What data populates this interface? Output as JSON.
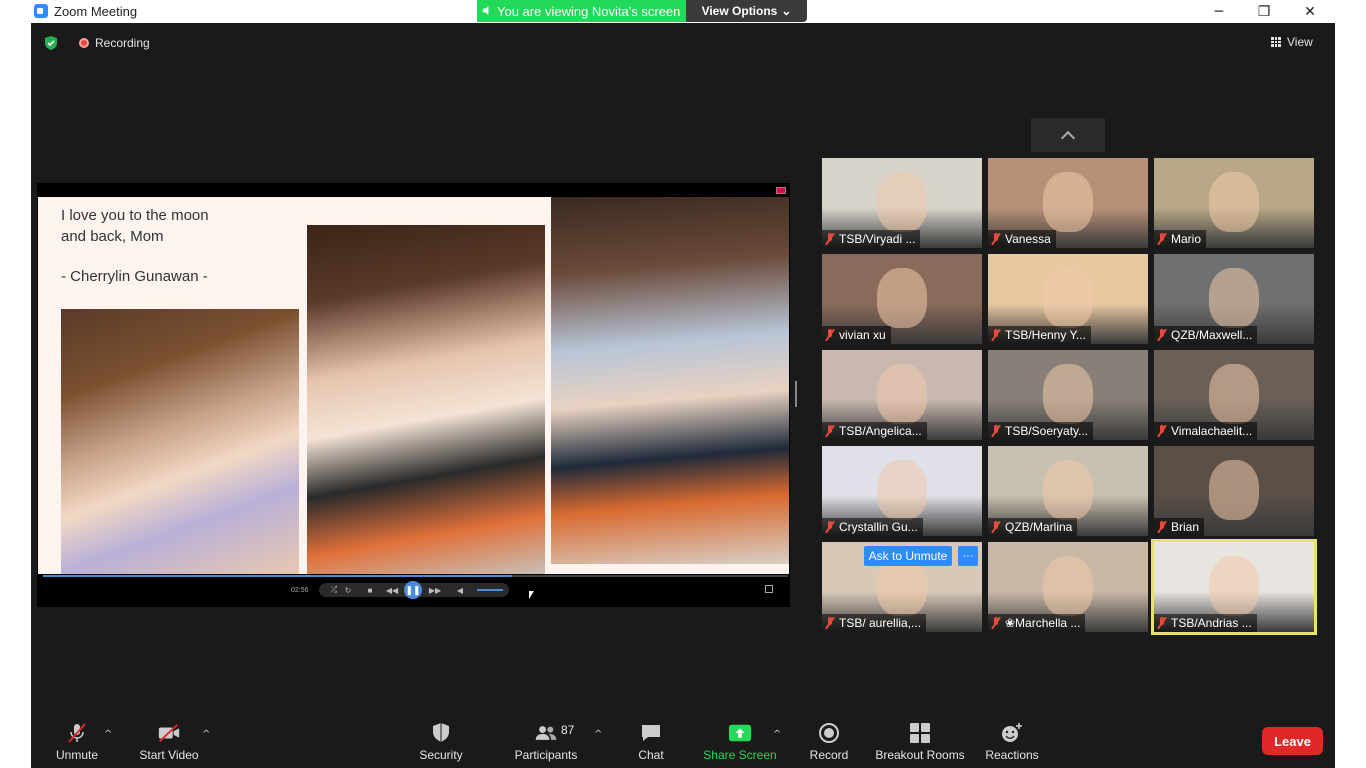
{
  "window": {
    "title": "Zoom Meeting",
    "minimize": "─",
    "maximize": "❐",
    "close": "✕"
  },
  "banner": {
    "viewing": "You are viewing Novita's screen",
    "view_options": "View Options",
    "view_options_caret": "⌄"
  },
  "header": {
    "recording": "Recording",
    "view": "View"
  },
  "share": {
    "slide_line1": "I love you to the moon",
    "slide_line2": "and back, Mom",
    "slide_author": "- Cherrylin Gunawan -",
    "time": "02:56",
    "progress": 0.63
  },
  "participants_grid": [
    {
      "name": "TSB/Viryadi ...",
      "muted": true,
      "bg": "#d8d4cc"
    },
    {
      "name": "Vanessa",
      "muted": true,
      "bg": "#b89078"
    },
    {
      "name": "Mario",
      "muted": true,
      "bg": "#b8a888"
    },
    {
      "name": "vivian xu",
      "muted": true,
      "bg": "#8a6a5a"
    },
    {
      "name": "TSB/Henny Y...",
      "muted": true,
      "bg": "#e8c8a0"
    },
    {
      "name": "QZB/Maxwell...",
      "muted": true,
      "bg": "#707070"
    },
    {
      "name": "TSB/Angelica...",
      "muted": true,
      "bg": "#c8b8b0"
    },
    {
      "name": "TSB/Soeryaty...",
      "muted": true,
      "bg": "#888078"
    },
    {
      "name": "Vimalachaelit...",
      "muted": true,
      "bg": "#6a6058"
    },
    {
      "name": "Crystallin Gu...",
      "muted": true,
      "bg": "#e0e0e8"
    },
    {
      "name": "QZB/Marlina",
      "muted": true,
      "bg": "#c8c0b0"
    },
    {
      "name": "Brian",
      "muted": true,
      "bg": "#5a5048"
    },
    {
      "name": "TSB/ aurellia,...",
      "muted": true,
      "bg": "#d8c8b8"
    },
    {
      "name": "❀Marchella ...",
      "muted": true,
      "bg": "#c8b8a8"
    },
    {
      "name": "TSB/Andrias ...",
      "muted": true,
      "bg": "#e8e4e0"
    }
  ],
  "tile_actions": {
    "ask_to_unmute": "Ask to Unmute",
    "more": "···"
  },
  "toolbar": {
    "unmute": "Unmute",
    "start_video": "Start Video",
    "security": "Security",
    "participants": "Participants",
    "participants_count": "87",
    "chat": "Chat",
    "share_screen": "Share Screen",
    "record": "Record",
    "breakout_rooms": "Breakout Rooms",
    "reactions": "Reactions",
    "leave": "Leave",
    "caret": "^"
  },
  "colors": {
    "accent": "#2d8cff",
    "banner_green": "#23d959",
    "leave_red": "#e02828",
    "share_green": "#23d959"
  }
}
